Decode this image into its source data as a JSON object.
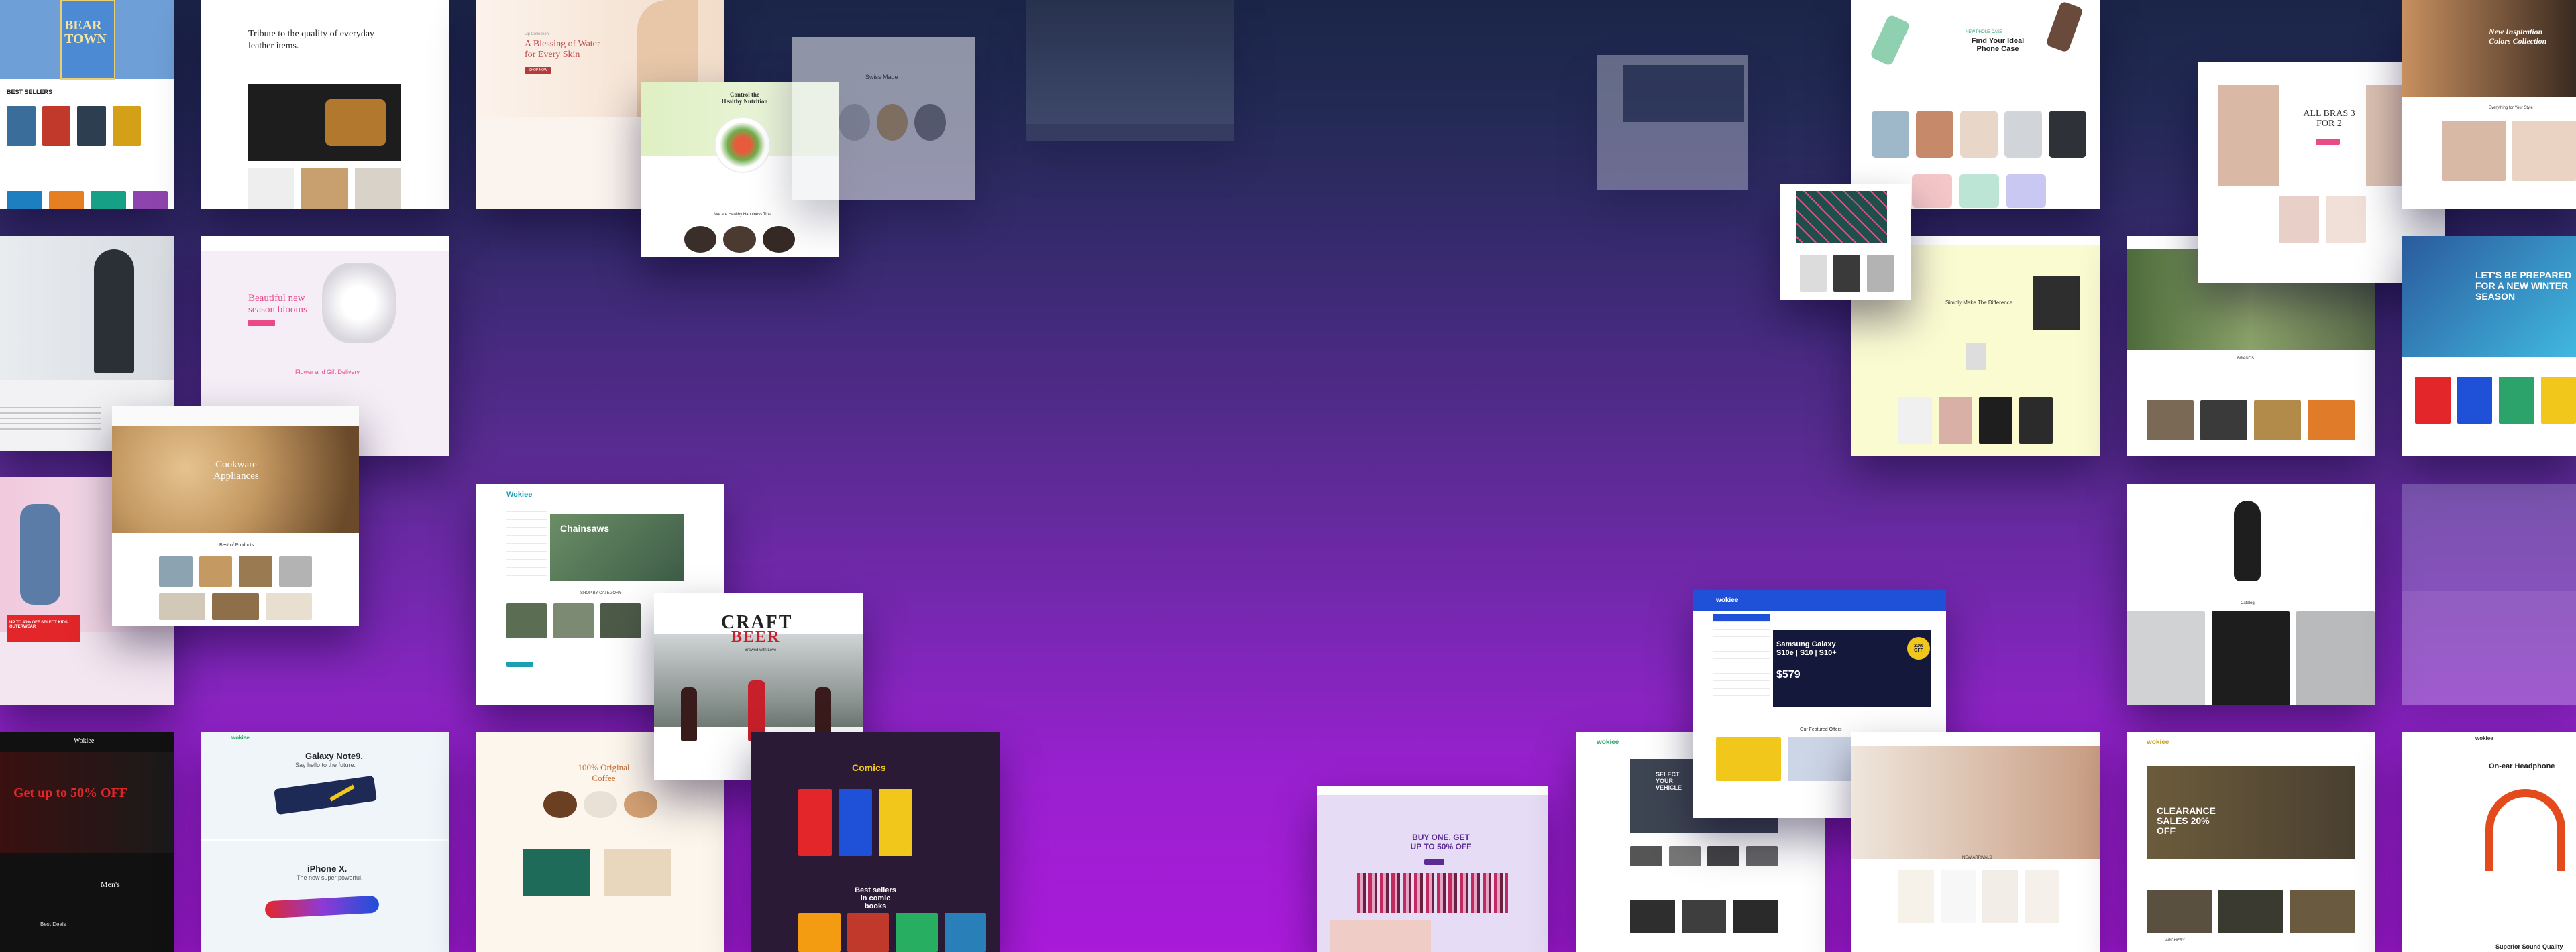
{
  "colors": {
    "accent_blue": "#1e50d8",
    "accent_red": "#e3262a",
    "accent_pink": "#e94b89",
    "accent_green": "#2ca36a",
    "accent_yellow": "#f2c71b"
  },
  "templates": [
    {
      "id": "books",
      "headline": "BEAR TOWN",
      "kicker": "Bear Town",
      "section": "BEST SELLERS"
    },
    {
      "id": "leather",
      "headline": "Tribute to the quality of everyday leather items."
    },
    {
      "id": "skincare",
      "kicker": "Lip Collection",
      "headline": "A Blessing of Water for Every Skin",
      "cta": "SHOP NOW"
    },
    {
      "id": "nutrition",
      "headline": "Control the Healthy Nutrition",
      "cta": "SHOP NOW",
      "sub": "We are Healthy Happiness Tips"
    },
    {
      "id": "watches",
      "headline": "Swiss Made"
    },
    {
      "id": "phone",
      "kicker": "NEW PHONE CASE",
      "headline": "Find Your Ideal Phone Case"
    },
    {
      "id": "lingerie",
      "headline": "ALL BRAS 3 FOR 2",
      "sub": "Everything for Your Style",
      "cta": "SHOP NOW"
    },
    {
      "id": "fashion-right",
      "headline": "New Inspiration Colors Collection",
      "sub": "Everything for Your Style"
    },
    {
      "id": "winter",
      "headline": "LET'S BE PREPARED FOR A NEW WINTER SEASON"
    },
    {
      "id": "blooms",
      "headline": "Beautiful new season blooms",
      "sub": "Flower and Gift Delivery"
    },
    {
      "id": "cookware",
      "headline": "Cookware Appliances",
      "sub": "Best of Products"
    },
    {
      "id": "tools",
      "logo": "Wokiee",
      "headline": "Chainsaws",
      "section": "SHOP BY CATEGORY"
    },
    {
      "id": "beer",
      "headline": "CRAFT",
      "headline2": "BEER",
      "sub": "Brewed with Love"
    },
    {
      "id": "kids",
      "headline": "UP TO 40% OFF SELECT KIDS OUTERWEAR"
    },
    {
      "id": "electronics",
      "logo": "wokiee",
      "headline": "Samsung Galaxy S10e | S10 | S10+",
      "price": "$579",
      "badge": "20% OFF",
      "section": "Our Featured Offers"
    },
    {
      "id": "gothic",
      "logo": "Wokiee",
      "headline": "Get up to 50% OFF",
      "sub": "Men's",
      "section": "Best Deals"
    },
    {
      "id": "phones",
      "logo": "wokiee",
      "headline": "Galaxy Note9.",
      "sub": "Say hello to the future.",
      "headline2": "iPhone X.",
      "sub2": "The new super powerful."
    },
    {
      "id": "coffee",
      "headline": "100% Original Coffee"
    },
    {
      "id": "comics",
      "headline": "Best sellers in comic books",
      "section": "Comics"
    },
    {
      "id": "cosmetics",
      "headline": "BUY ONE, GET UP TO 50% OFF",
      "cta": "SHOP NOW"
    },
    {
      "id": "auto",
      "logo": "wokiee",
      "headline": "SELECT YOUR VEHICLE"
    },
    {
      "id": "jewelry",
      "section": "NEW ARRIVALS"
    },
    {
      "id": "army",
      "logo": "wokiee",
      "headline": "CLEARANCE SALES 20% OFF",
      "section": "ARCHERY"
    },
    {
      "id": "audio",
      "logo": "wokiee",
      "headline": "On-ear Headphone",
      "sub": "Superior Sound Quality"
    },
    {
      "id": "vases",
      "section": "Catalog"
    },
    {
      "id": "tees",
      "headline": "Simply Make The Difference"
    },
    {
      "id": "outdoor",
      "section": "BRANDS"
    }
  ]
}
